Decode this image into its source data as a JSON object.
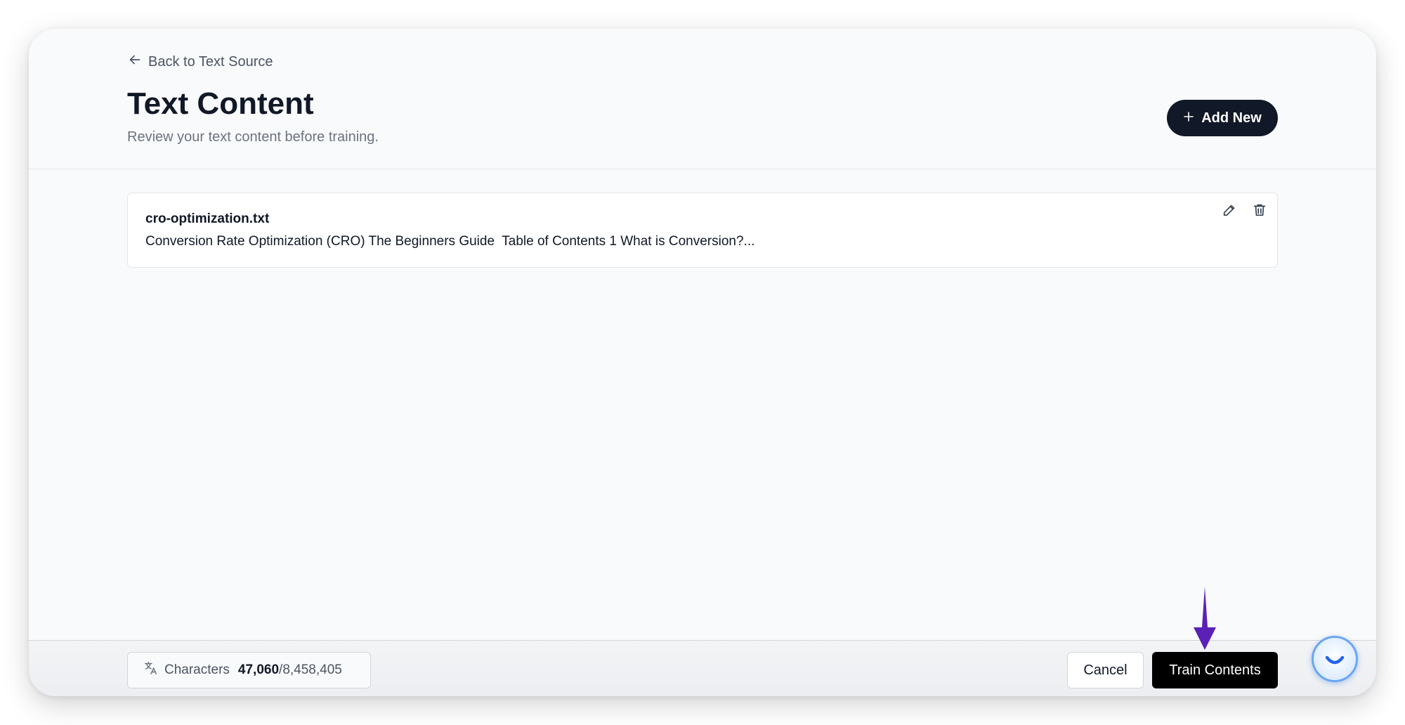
{
  "header": {
    "back_label": "Back to Text Source",
    "title": "Text Content",
    "subtitle": "Review your text content before training.",
    "add_new_label": "Add New"
  },
  "contents": [
    {
      "file_name": "cro-optimization.txt",
      "preview": "Conversion Rate Optimization (CRO) The Beginners Guide  Table of Contents 1 What is Conversion?..."
    }
  ],
  "footer": {
    "characters_label": "Characters",
    "characters_used": "47,060",
    "characters_limit": "/8,458,405",
    "cancel_label": "Cancel",
    "train_label": "Train Contents"
  },
  "icons": {
    "back": "arrow-left-icon",
    "add": "plus-icon",
    "edit": "pencil-icon",
    "delete": "trash-icon",
    "characters": "translate-icon",
    "pointer": "arrow-down-icon",
    "chat": "chat-widget-icon"
  },
  "colors": {
    "primary_button": "#111827",
    "train_button": "#000000",
    "pointer_arrow": "#5b21b6",
    "chat_widget": "#6aa6f3"
  }
}
